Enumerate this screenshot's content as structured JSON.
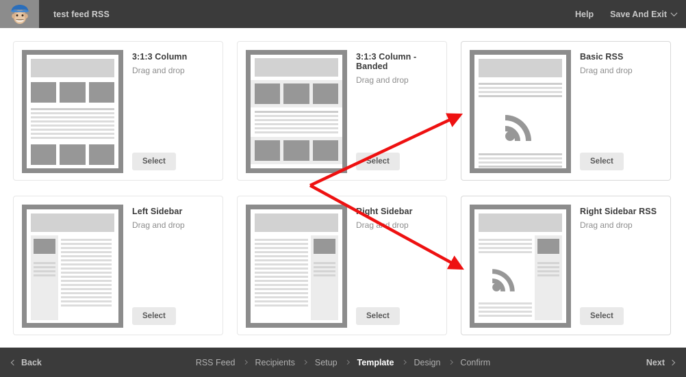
{
  "topbar": {
    "logo_icon": "mailchimp-freddie-logo",
    "campaign_title": "test feed RSS",
    "help_label": "Help",
    "save_exit_label": "Save And Exit",
    "dropdown_icon": "chevron-down-icon",
    "bg_color": "#3b3b3b",
    "logo_bg_color": "#8c8c8c"
  },
  "templates": [
    {
      "name": "3:1:3 Column",
      "type": "Drag and drop",
      "select_label": "Select",
      "layout": "three-one-three",
      "has_rss": false
    },
    {
      "name": "3:1:3 Column - Banded",
      "type": "Drag and drop",
      "select_label": "Select",
      "layout": "three-one-three-banded",
      "has_rss": false
    },
    {
      "name": "Basic RSS",
      "type": "Drag and drop",
      "select_label": "Select",
      "layout": "basic-rss",
      "has_rss": true
    },
    {
      "name": "Left Sidebar",
      "type": "Drag and drop",
      "select_label": "Select",
      "layout": "left-sidebar",
      "has_rss": false
    },
    {
      "name": "Right Sidebar",
      "type": "Drag and drop",
      "select_label": "Select",
      "layout": "right-sidebar",
      "has_rss": false
    },
    {
      "name": "Right Sidebar RSS",
      "type": "Drag and drop",
      "select_label": "Select",
      "layout": "right-sidebar-rss",
      "has_rss": true
    }
  ],
  "annotation": {
    "color": "#ee1111",
    "description": "red arrow pointing from between the columns to the two RSS templates",
    "arrow_targets": [
      "Basic RSS",
      "Right Sidebar RSS"
    ]
  },
  "footer": {
    "back_label": "Back",
    "back_icon": "chevron-left-icon",
    "next_label": "Next",
    "next_icon": "chevron-right-icon",
    "steps": [
      {
        "label": "RSS Feed",
        "active": false
      },
      {
        "label": "Recipients",
        "active": false
      },
      {
        "label": "Setup",
        "active": false
      },
      {
        "label": "Template",
        "active": true
      },
      {
        "label": "Design",
        "active": false
      },
      {
        "label": "Confirm",
        "active": false
      }
    ],
    "bg_color": "#3b3b3b"
  }
}
